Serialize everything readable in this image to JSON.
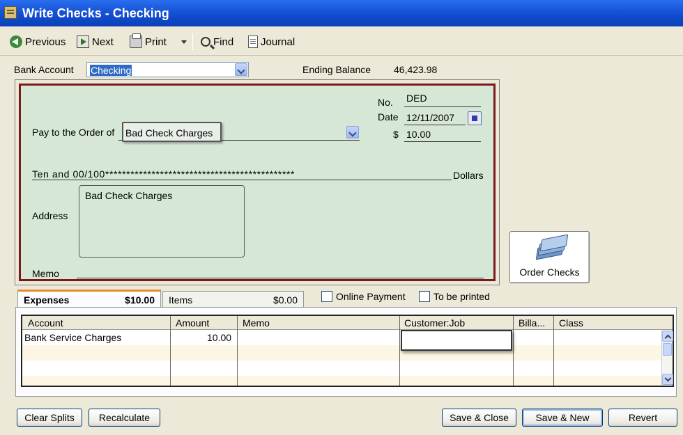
{
  "window": {
    "title": "Write Checks - Checking"
  },
  "toolbar": {
    "previous": "Previous",
    "next": "Next",
    "print": "Print",
    "find": "Find",
    "journal": "Journal"
  },
  "bank": {
    "label": "Bank Account",
    "value": "Checking",
    "ending_balance_label": "Ending Balance",
    "ending_balance": "46,423.98"
  },
  "check": {
    "no_label": "No.",
    "no_value": "DED",
    "date_label": "Date",
    "date_value": "12/11/2007",
    "amount_symbol": "$",
    "amount": "10.00",
    "pay_to_label": "Pay to the Order of",
    "payee": "Bad Check Charges",
    "amount_words": "Ten and 00/100*********************************************",
    "dollars_label": "Dollars",
    "address_label": "Address",
    "address": "Bad Check Charges",
    "memo_label": "Memo"
  },
  "order_checks": {
    "label": "Order Checks"
  },
  "tabs": {
    "expenses_label": "Expenses",
    "expenses_amount": "$10.00",
    "items_label": "Items",
    "items_amount": "$0.00"
  },
  "options": {
    "online_payment": "Online Payment",
    "to_be_printed": "To be printed"
  },
  "grid": {
    "columns": [
      "Account",
      "Amount",
      "Memo",
      "Customer:Job",
      "Billa...",
      "Class"
    ],
    "rows": [
      {
        "account": "Bank Service Charges",
        "amount": "10.00",
        "memo": "",
        "customer_job": "",
        "billable": "",
        "class": ""
      }
    ]
  },
  "buttons": {
    "clear_splits": "Clear Splits",
    "recalculate": "Recalculate",
    "save_close": "Save & Close",
    "save_new": "Save & New",
    "revert": "Revert"
  },
  "colors": {
    "title_bar": "#1552d6",
    "check_background": "#d6e8d5",
    "check_border": "#7a1a1a",
    "tab_accent": "#e68b2c",
    "selection": "#316ac5"
  },
  "icons": [
    "app-icon",
    "previous-icon",
    "next-icon",
    "print-icon",
    "find-icon",
    "journal-icon",
    "calendar-icon",
    "order-checks-icon"
  ]
}
